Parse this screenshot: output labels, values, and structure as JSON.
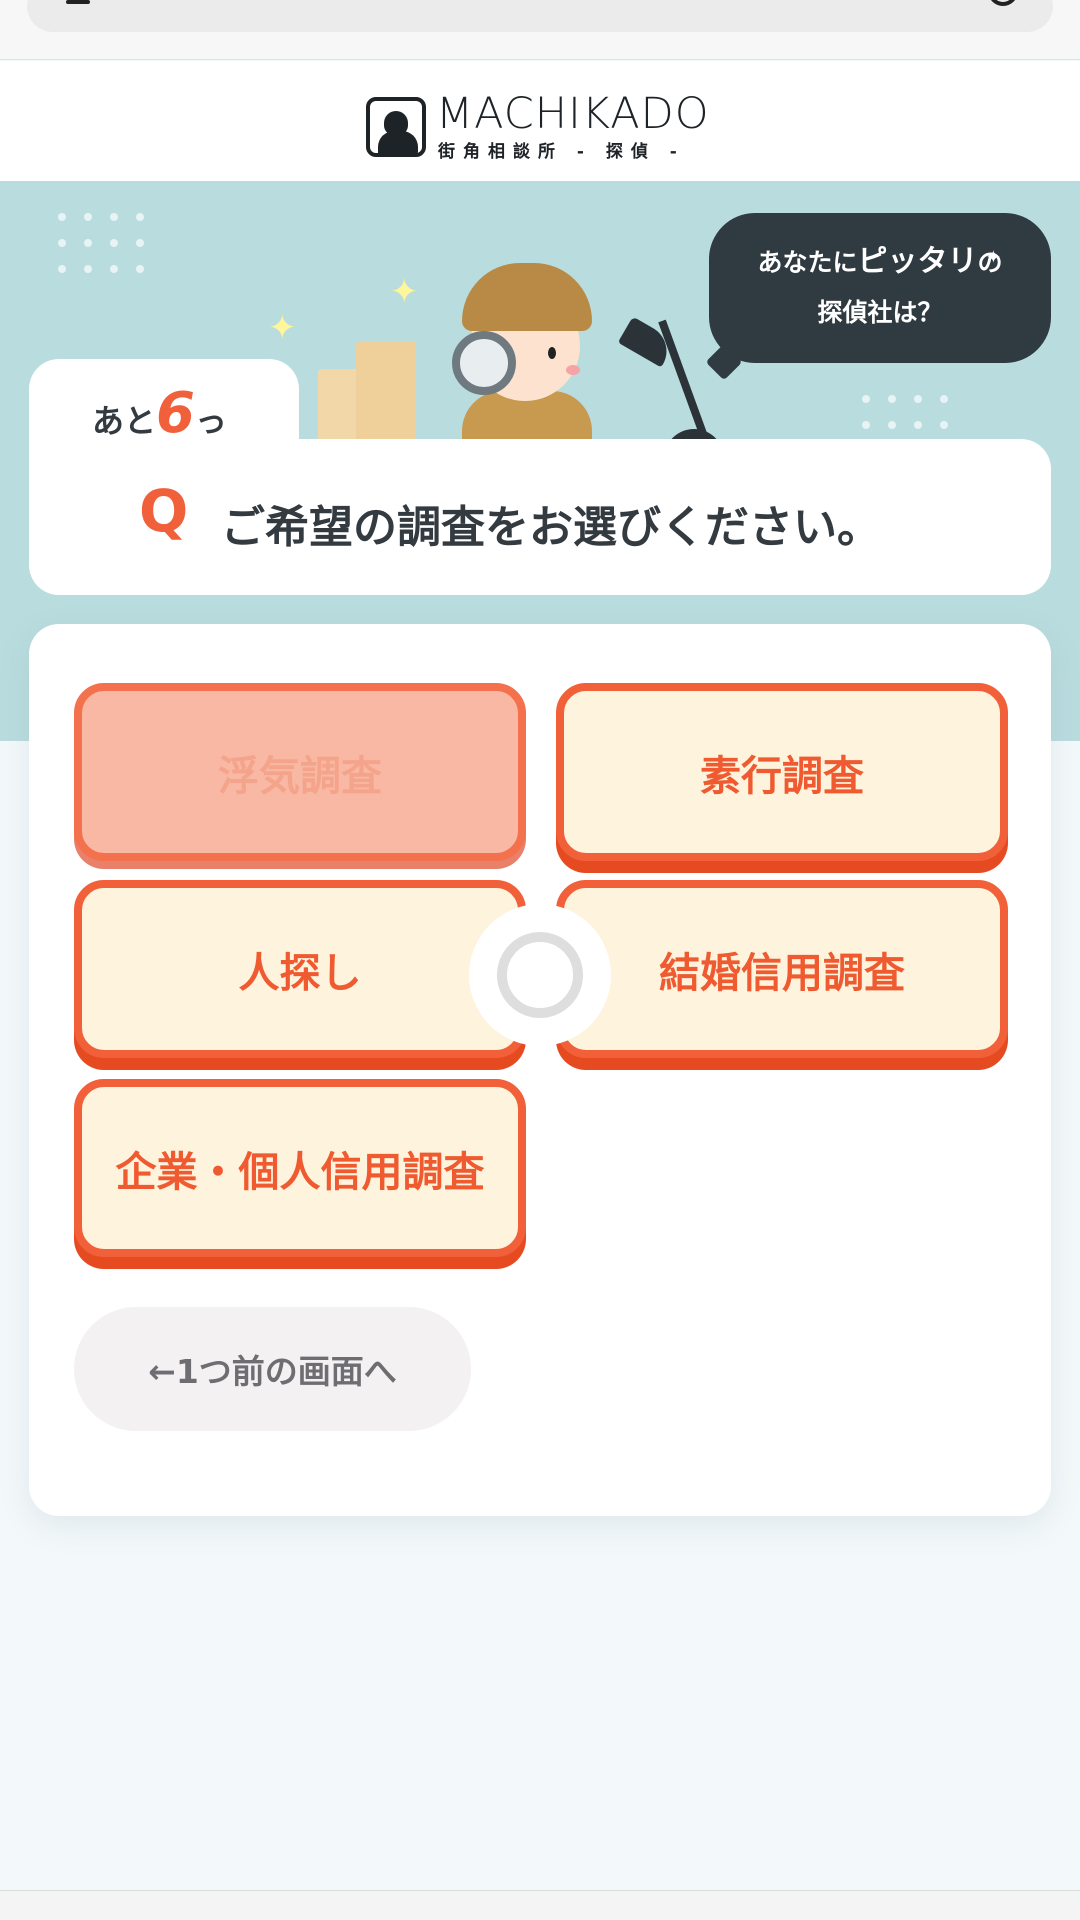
{
  "header": {
    "logo_text": "MACHIKADO",
    "logo_sub": "街角相談所 - 探偵 -"
  },
  "hero": {
    "speech_line1_pre": "あなたに",
    "speech_line1_em": "ピッタリ",
    "speech_line1_post": "の",
    "speech_line2": "探偵社は？"
  },
  "progress": {
    "prefix": "あと",
    "remaining": "6",
    "suffix": "っ"
  },
  "question": {
    "mark": "Q",
    "text": "ご希望の調査をお選びください。"
  },
  "options": [
    {
      "label": "浮気調査",
      "selected": true
    },
    {
      "label": "素行調査",
      "selected": false
    },
    {
      "label": "人探し",
      "selected": false
    },
    {
      "label": "結婚信用調査",
      "selected": false
    },
    {
      "label": "企業・個人信用調査",
      "selected": false
    }
  ],
  "back_button": {
    "label": "←1つ前の画面へ"
  },
  "colors": {
    "accent": "#f0613b",
    "hero_bg": "#b9dcde",
    "option_bg": "#fef3dc",
    "selected_bg": "#f8b8a4"
  },
  "icons": [
    "menu-icon",
    "account-icon",
    "detective-logo-icon",
    "sparkle-icon",
    "loading-spinner-icon"
  ]
}
